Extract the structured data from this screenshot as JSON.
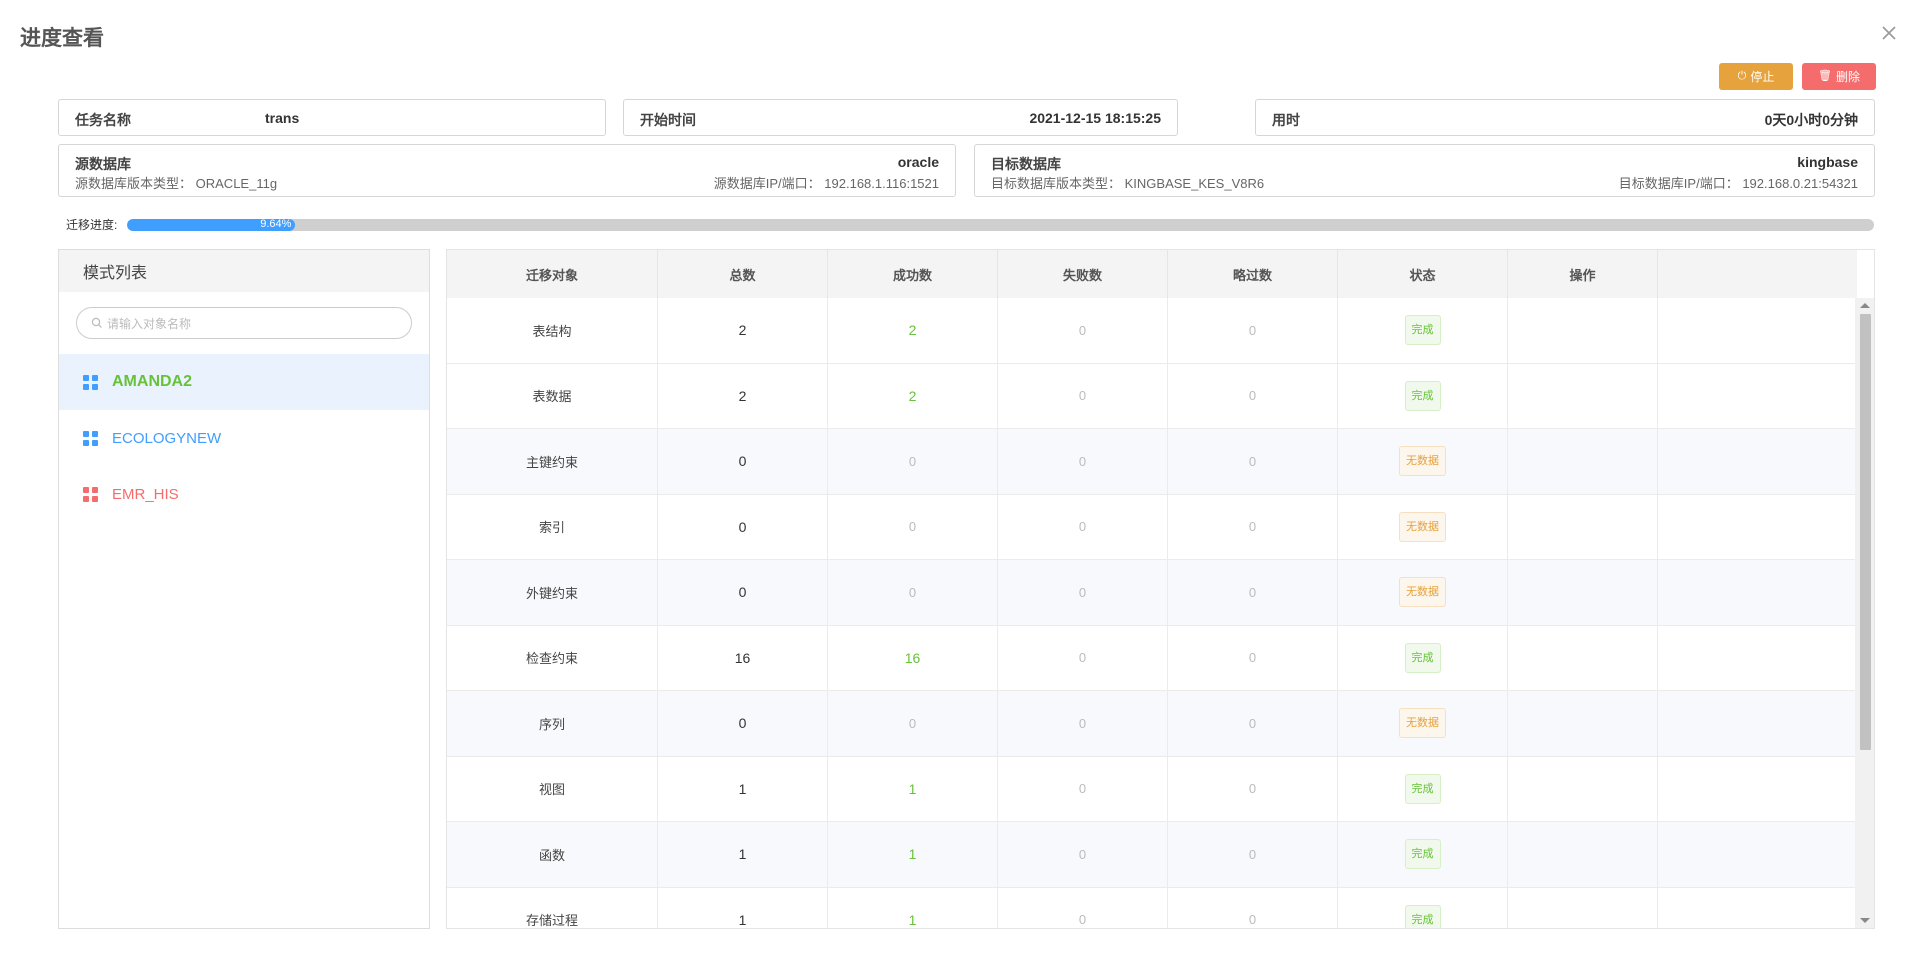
{
  "dialog": {
    "title": "进度查看"
  },
  "actions": {
    "stop_label": "停止",
    "delete_label": "删除",
    "stop_icon": "power-icon",
    "delete_icon": "trash-icon",
    "close_icon": "close-icon"
  },
  "task": {
    "name_label": "任务名称",
    "name_value": "trans",
    "start_label": "开始时间",
    "start_value": "2021-12-15 18:15:25",
    "duration_label": "用时",
    "duration_value": "0天0小时0分钟"
  },
  "source_db": {
    "label": "源数据库",
    "type": "oracle",
    "version_label": "源数据库版本类型：",
    "version_value": "ORACLE_11g",
    "addr_label": "源数据库IP/端口：",
    "addr_value": "192.168.1.116:1521"
  },
  "target_db": {
    "label": "目标数据库",
    "type": "kingbase",
    "version_label": "目标数据库版本类型：",
    "version_value": "KINGBASE_KES_V8R6",
    "addr_label": "目标数据库IP/端口：",
    "addr_value": "192.168.0.21:54321"
  },
  "progress": {
    "label": "迁移进度:",
    "percent": 9.64,
    "text": "9.64%"
  },
  "schemas": {
    "header": "模式列表",
    "search_placeholder": "请输入对象名称",
    "items": [
      {
        "name": "AMANDA2",
        "color": "#67c23a",
        "icon_color": "#409eff",
        "active": true
      },
      {
        "name": "ECOLOGYNEW",
        "color": "#409eff",
        "icon_color": "#409eff",
        "active": false
      },
      {
        "name": "EMR_HIS",
        "color": "#f56c6c",
        "icon_color": "#f56c6c",
        "active": false
      }
    ]
  },
  "table": {
    "columns": [
      "迁移对象",
      "总数",
      "成功数",
      "失败数",
      "略过数",
      "状态",
      "操作"
    ],
    "rows": [
      {
        "object": "表结构",
        "total": "2",
        "success": "2",
        "failed": "0",
        "skipped": "0",
        "status": "完成"
      },
      {
        "object": "表数据",
        "total": "2",
        "success": "2",
        "failed": "0",
        "skipped": "0",
        "status": "完成"
      },
      {
        "object": "主键约束",
        "total": "0",
        "success": "0",
        "failed": "0",
        "skipped": "0",
        "status": "无数据"
      },
      {
        "object": "索引",
        "total": "0",
        "success": "0",
        "failed": "0",
        "skipped": "0",
        "status": "无数据"
      },
      {
        "object": "外键约束",
        "total": "0",
        "success": "0",
        "failed": "0",
        "skipped": "0",
        "status": "无数据"
      },
      {
        "object": "检查约束",
        "total": "16",
        "success": "16",
        "failed": "0",
        "skipped": "0",
        "status": "完成"
      },
      {
        "object": "序列",
        "total": "0",
        "success": "0",
        "failed": "0",
        "skipped": "0",
        "status": "无数据"
      },
      {
        "object": "视图",
        "total": "1",
        "success": "1",
        "failed": "0",
        "skipped": "0",
        "status": "完成"
      },
      {
        "object": "函数",
        "total": "1",
        "success": "1",
        "failed": "0",
        "skipped": "0",
        "status": "完成"
      },
      {
        "object": "存储过程",
        "total": "1",
        "success": "1",
        "failed": "0",
        "skipped": "0",
        "status": "完成"
      }
    ]
  }
}
